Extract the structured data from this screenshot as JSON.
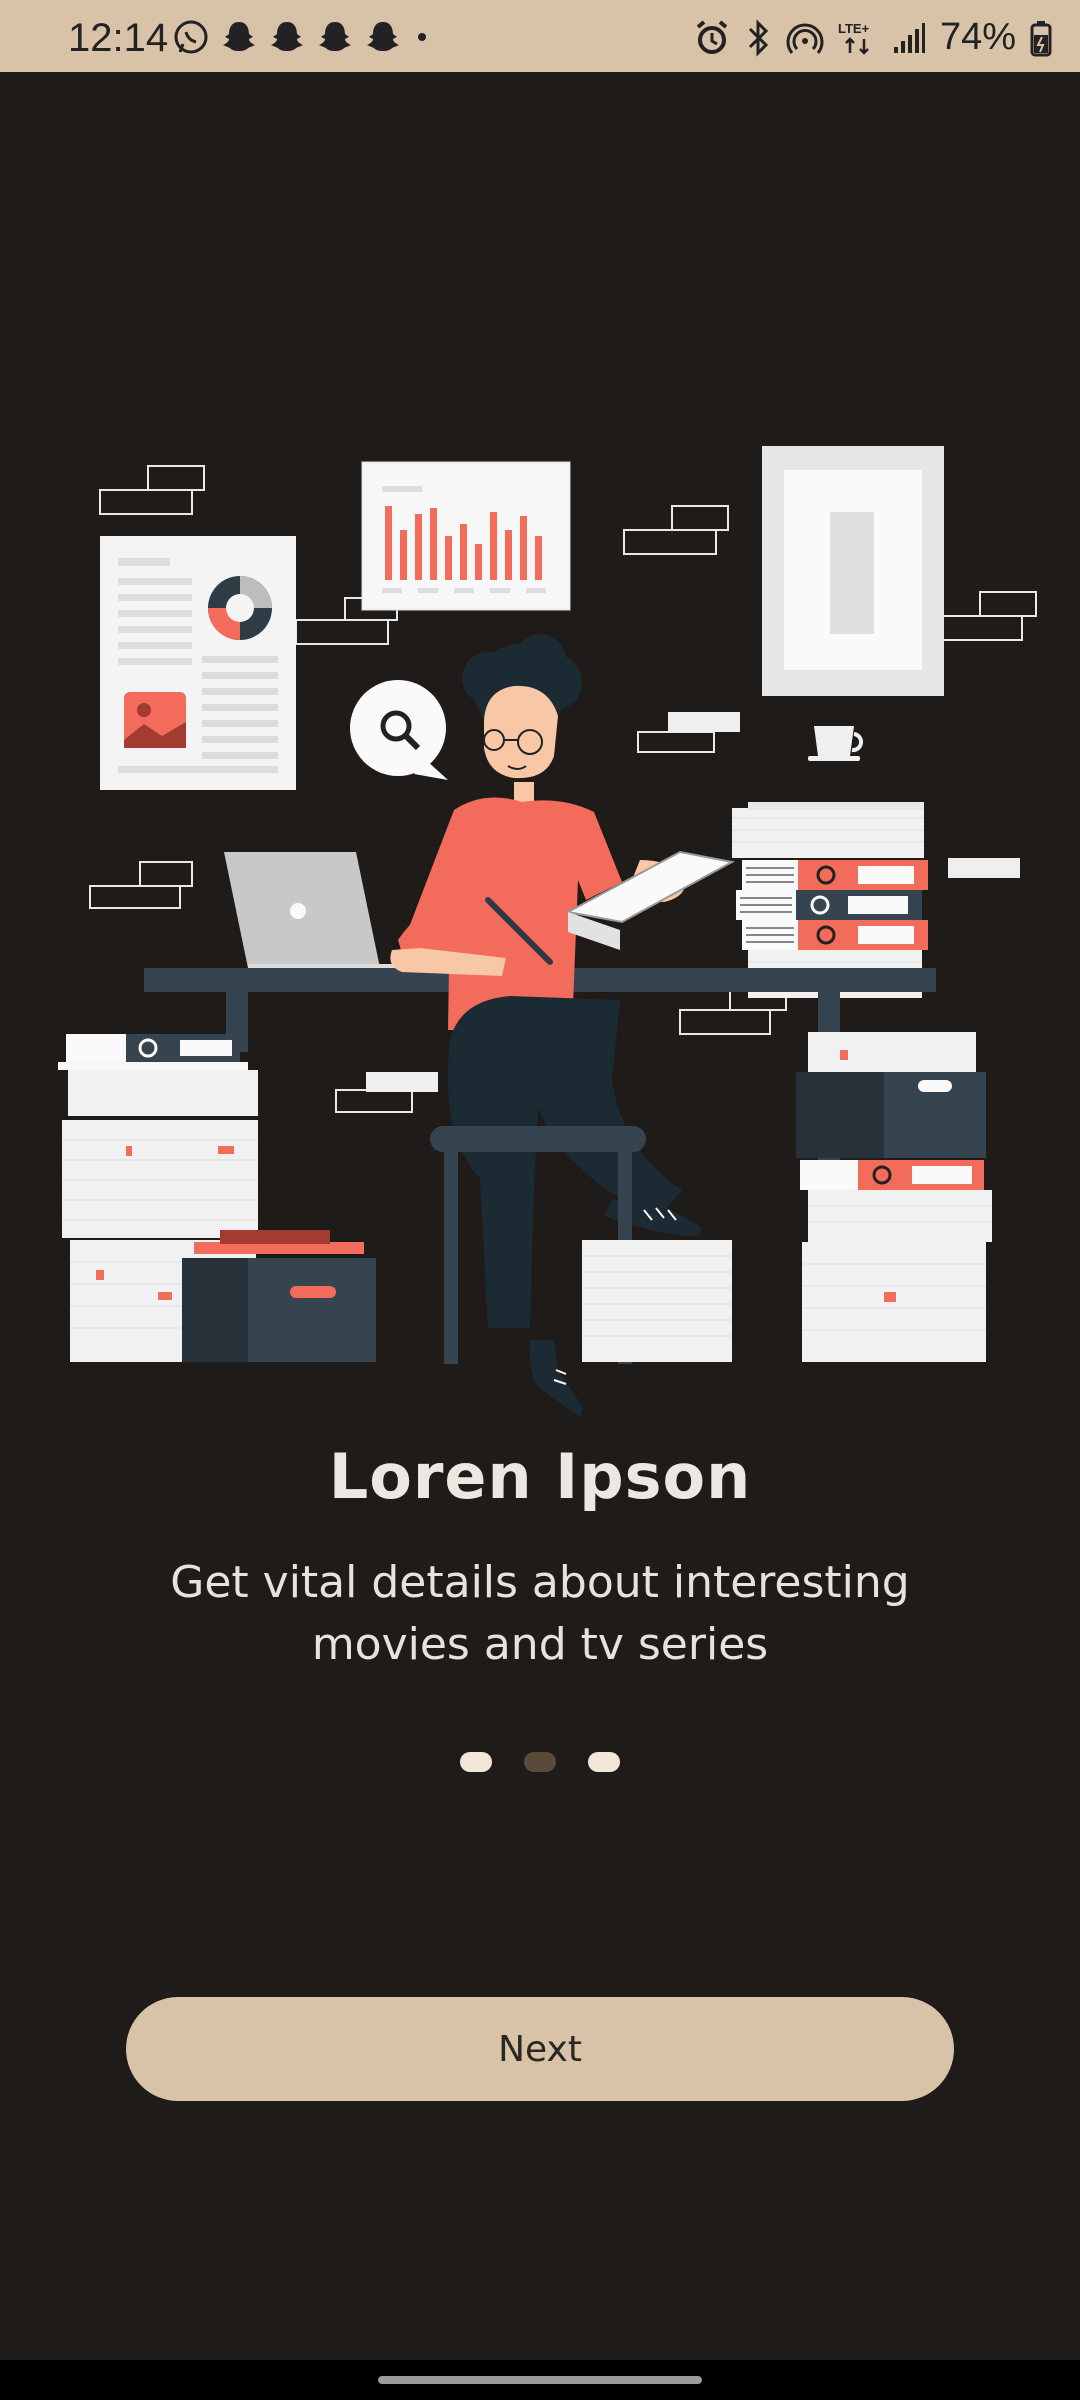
{
  "status_bar": {
    "time": "12:14",
    "battery_text": "74%",
    "left_icons": [
      "whatsapp-icon",
      "snapchat-icon",
      "snapchat-icon",
      "snapchat-icon",
      "snapchat-icon",
      "more-dot-icon"
    ],
    "right_icons": [
      "alarm-icon",
      "bluetooth-icon",
      "hotspot-icon",
      "lte-icon",
      "signal-icon",
      "battery-icon"
    ]
  },
  "onboarding": {
    "title": "Loren Ipson",
    "subtitle": "Get vital details about interesting movies and tv series",
    "pages_total": 3,
    "active_page": 2
  },
  "actions": {
    "next_label": "Next"
  },
  "colors": {
    "background": "#1f1b19",
    "accent": "#d8c3a8",
    "dot_active": "#5a4a3a",
    "dot_inactive": "#f2e6d6",
    "illustration_accent": "#f26b5b"
  }
}
